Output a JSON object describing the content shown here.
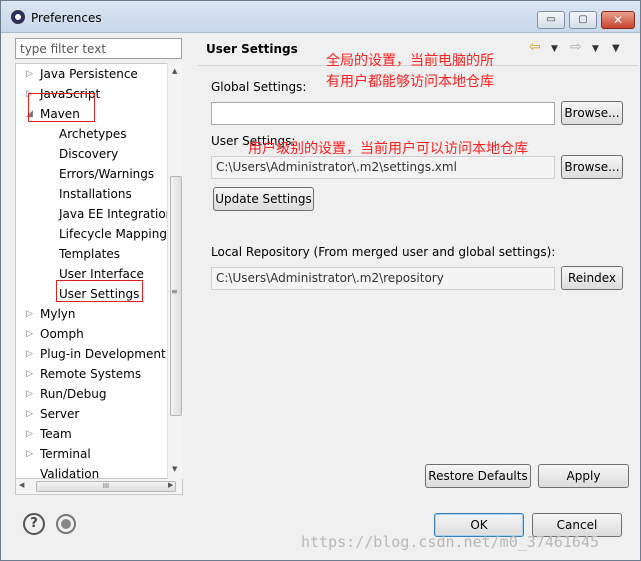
{
  "window": {
    "title": "Preferences",
    "controls": {
      "minimize": "▭",
      "maximize": "▢",
      "close": "✕"
    }
  },
  "left": {
    "filter_placeholder": "type filter text",
    "tree": [
      {
        "label": "Java Persistence",
        "level": 0,
        "arrow": "▷"
      },
      {
        "label": "JavaScript",
        "level": 0,
        "arrow": "▷"
      },
      {
        "label": "Maven",
        "level": 0,
        "arrow": "◢"
      },
      {
        "label": "Archetypes",
        "level": 1,
        "arrow": ""
      },
      {
        "label": "Discovery",
        "level": 1,
        "arrow": ""
      },
      {
        "label": "Errors/Warnings",
        "level": 1,
        "arrow": ""
      },
      {
        "label": "Installations",
        "level": 1,
        "arrow": ""
      },
      {
        "label": "Java EE Integration",
        "level": 1,
        "arrow": ""
      },
      {
        "label": "Lifecycle Mapping",
        "level": 1,
        "arrow": ""
      },
      {
        "label": "Templates",
        "level": 1,
        "arrow": ""
      },
      {
        "label": "User Interface",
        "level": 1,
        "arrow": ""
      },
      {
        "label": "User Settings",
        "level": 1,
        "arrow": ""
      },
      {
        "label": "Mylyn",
        "level": 0,
        "arrow": "▷"
      },
      {
        "label": "Oomph",
        "level": 0,
        "arrow": "▷"
      },
      {
        "label": "Plug-in Development",
        "level": 0,
        "arrow": "▷"
      },
      {
        "label": "Remote Systems",
        "level": 0,
        "arrow": "▷"
      },
      {
        "label": "Run/Debug",
        "level": 0,
        "arrow": "▷"
      },
      {
        "label": "Server",
        "level": 0,
        "arrow": "▷"
      },
      {
        "label": "Team",
        "level": 0,
        "arrow": "▷"
      },
      {
        "label": "Terminal",
        "level": 0,
        "arrow": "▷"
      },
      {
        "label": "Validation",
        "level": 0,
        "arrow": ""
      }
    ],
    "hscroll_grip": "III",
    "vscroll_grip": "≡"
  },
  "right": {
    "title": "User Settings",
    "global_settings_label": "Global Settings:",
    "global_settings_value": "",
    "browse_label": "Browse...",
    "user_settings_label": "User Settings:",
    "user_settings_value": "C:\\Users\\Administrator\\.m2\\settings.xml",
    "update_label": "Update Settings",
    "local_repo_label": "Local Repository (From merged user and global settings):",
    "local_repo_value": "C:\\Users\\Administrator\\.m2\\repository",
    "reindex_label": "Reindex",
    "restore_label": "Restore Defaults",
    "apply_label": "Apply"
  },
  "annotations": {
    "global_line1": "全局的设置，当前电脑的所",
    "global_line2": "有用户都能够访问本地仓库",
    "user": "用户级别的设置，当前用户可以访问本地仓库"
  },
  "footer": {
    "ok_label": "OK",
    "cancel_label": "Cancel",
    "help_glyph": "?"
  },
  "watermark": "https://blog.csdn.net/m0_37461645"
}
